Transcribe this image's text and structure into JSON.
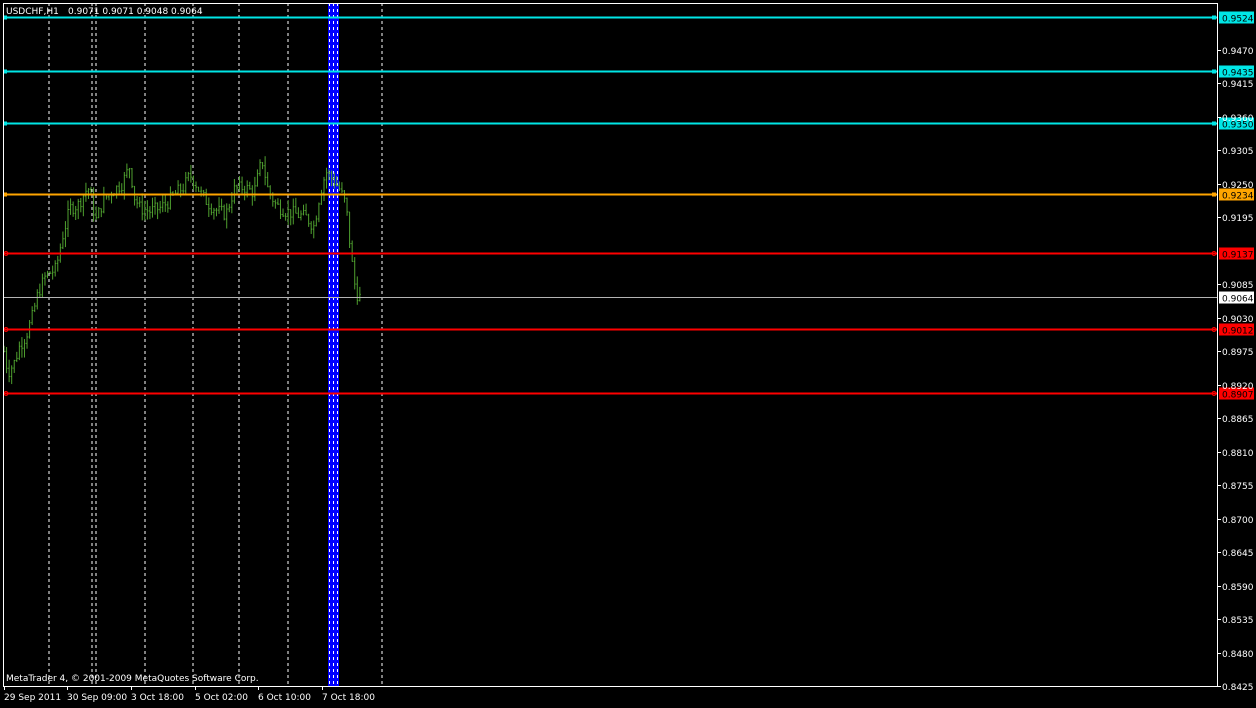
{
  "header": {
    "symbol": "USDCHF,H1",
    "ohlc": "0.9071 0.9071 0.9048 0.9064"
  },
  "footer": {
    "copyright": "MetaTrader 4, © 2001-2009 MetaQuotes Software Corp."
  },
  "colors": {
    "background": "#000000",
    "frame": "#ffffff",
    "axis_text": "#ffffff",
    "bar": "#4fa02f",
    "bid_line": "#b4b4b4",
    "cyan_level": "#00e6e6",
    "orange_level": "#ffa500",
    "red_level": "#ff0000",
    "blue_band": "#0000ff"
  },
  "chart_data": {
    "type": "bar",
    "title": "USDCHF,H1",
    "ylim": [
      0.8425,
      0.9547
    ],
    "grid": false,
    "y_ticks": [
      "0.9470",
      "0.9415",
      "0.9360",
      "0.9305",
      "0.9250",
      "0.9195",
      "0.9085",
      "0.9030",
      "0.8975",
      "0.8920",
      "0.8865",
      "0.8810",
      "0.8755",
      "0.8700",
      "0.8645",
      "0.8590",
      "0.8535",
      "0.8480",
      "0.8425"
    ],
    "x_labels": [
      "29 Sep 2011",
      "30 Sep 09:00",
      "3 Oct 18:00",
      "5 Oct 02:00",
      "6 Oct 10:00",
      "7 Oct 18:00"
    ],
    "bid_price": "0.9064",
    "levels": [
      {
        "price": "0.9524",
        "kind": "cyan"
      },
      {
        "price": "0.9435",
        "kind": "cyan"
      },
      {
        "price": "0.9350",
        "kind": "cyan"
      },
      {
        "price": "0.9234",
        "kind": "orange"
      },
      {
        "price": "0.9137",
        "kind": "red"
      },
      {
        "price": "0.9012",
        "kind": "red"
      },
      {
        "price": "0.8907",
        "kind": "red"
      }
    ],
    "bar_count": 140,
    "close_path": [
      [
        0,
        0.901
      ],
      [
        8,
        0.894
      ],
      [
        14,
        0.8955
      ],
      [
        20,
        0.8985
      ],
      [
        26,
        0.9
      ],
      [
        32,
        0.903
      ],
      [
        38,
        0.907
      ],
      [
        46,
        0.91
      ],
      [
        56,
        0.911
      ],
      [
        62,
        0.916
      ],
      [
        70,
        0.921
      ],
      [
        78,
        0.9215
      ],
      [
        88,
        0.9245
      ],
      [
        96,
        0.919
      ],
      [
        104,
        0.9225
      ],
      [
        114,
        0.924
      ],
      [
        122,
        0.925
      ],
      [
        130,
        0.928
      ],
      [
        134,
        0.923
      ],
      [
        140,
        0.921
      ],
      [
        150,
        0.9205
      ],
      [
        160,
        0.921
      ],
      [
        168,
        0.922
      ],
      [
        176,
        0.9235
      ],
      [
        184,
        0.9245
      ],
      [
        190,
        0.9265
      ],
      [
        196,
        0.925
      ],
      [
        202,
        0.923
      ],
      [
        210,
        0.9215
      ],
      [
        218,
        0.9205
      ],
      [
        226,
        0.92
      ],
      [
        234,
        0.924
      ],
      [
        244,
        0.9245
      ],
      [
        254,
        0.9235
      ],
      [
        262,
        0.929
      ],
      [
        268,
        0.924
      ],
      [
        276,
        0.9215
      ],
      [
        286,
        0.9205
      ],
      [
        296,
        0.92
      ],
      [
        306,
        0.9195
      ],
      [
        314,
        0.918
      ],
      [
        320,
        0.9235
      ],
      [
        326,
        0.927
      ],
      [
        334,
        0.9255
      ],
      [
        340,
        0.924
      ],
      [
        346,
        0.9215
      ],
      [
        350,
        0.915
      ],
      [
        354,
        0.909
      ],
      [
        358,
        0.9064
      ]
    ]
  }
}
